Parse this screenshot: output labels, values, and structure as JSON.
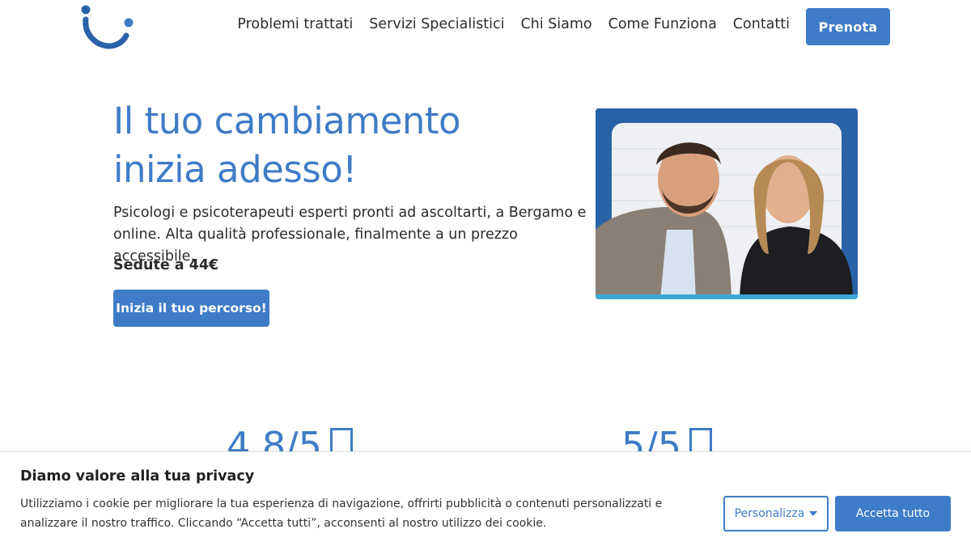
{
  "header": {
    "logo_name": "logo-icon",
    "nav": [
      {
        "label": "Problemi trattati"
      },
      {
        "label": "Servizi Specialistici"
      },
      {
        "label": "Chi Siamo"
      },
      {
        "label": "Come Funziona"
      },
      {
        "label": "Contatti"
      }
    ],
    "cta_label": "Prenota"
  },
  "hero": {
    "title_line1": "Il tuo cambiamento",
    "title_line2": "inizia adesso!",
    "description": "Psicologi e psicoterapeuti esperti pronti ad ascoltarti, a Bergamo e online. Alta qualità professionale, finalmente a un prezzo accessibile.",
    "price": "Sedute a 44€",
    "cta_label": "Inizia il tuo percorso!"
  },
  "ratings": [
    {
      "value": "4.8/5"
    },
    {
      "value": "5/5"
    }
  ],
  "cookie_banner": {
    "title": "Diamo valore alla tua privacy",
    "text": "Utilizziamo i cookie per migliorare la tua esperienza di navigazione, offrirti pubblicità o contenuti personalizzati e analizzare il nostro traffico. Cliccando “Accetta tutti”, acconsenti al nostro utilizzo dei cookie.",
    "customize_label": "Personalizza",
    "accept_label": "Accetta tutto"
  },
  "colors": {
    "brand": "#3f7cc7",
    "photo_bg": "#2a62a8",
    "text": "#2b2b2b"
  }
}
